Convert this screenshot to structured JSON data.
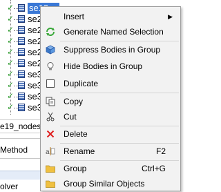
{
  "tree": {
    "rows": [
      {
        "label": "se19_nodes",
        "selected": true
      },
      {
        "label": "se2",
        "selected": false
      },
      {
        "label": "se2",
        "selected": false
      },
      {
        "label": "se2",
        "selected": false
      },
      {
        "label": "se2",
        "selected": false
      },
      {
        "label": "se2",
        "selected": false
      },
      {
        "label": "se3",
        "selected": false
      },
      {
        "label": "se3",
        "selected": false
      },
      {
        "label": "se3",
        "selected": false
      },
      {
        "label": "se3",
        "selected": false
      }
    ]
  },
  "details": {
    "name_value": "e19_nodes\"",
    "method_label": "Method",
    "solver_label": "olver"
  },
  "context_menu": {
    "items": [
      {
        "label": "Insert",
        "icon": "none",
        "has_submenu": true
      },
      {
        "label": "Generate Named Selection",
        "icon": "refresh-green-icon"
      },
      {
        "label": "Suppress Bodies in Group",
        "icon": "cube-icon"
      },
      {
        "label": "Hide Bodies in Group",
        "icon": "lightbulb-icon"
      },
      {
        "label": "Duplicate",
        "icon": "duplicate-icon"
      },
      {
        "label": "Copy",
        "icon": "copy-icon"
      },
      {
        "label": "Cut",
        "icon": "scissors-icon"
      },
      {
        "label": "Delete",
        "icon": "delete-x-icon"
      },
      {
        "label": "Rename",
        "icon": "rename-icon",
        "shortcut": "F2"
      },
      {
        "label": "Group",
        "icon": "folder-icon",
        "shortcut": "Ctrl+G"
      },
      {
        "label": "Group Similar Objects",
        "icon": "folder-icon"
      }
    ]
  },
  "colors": {
    "selection": "#3a78d6",
    "check": "#2e9a2e",
    "menu_bg": "#f2f2f2",
    "delete_red": "#e02020",
    "folder_yellow": "#f0c040"
  }
}
